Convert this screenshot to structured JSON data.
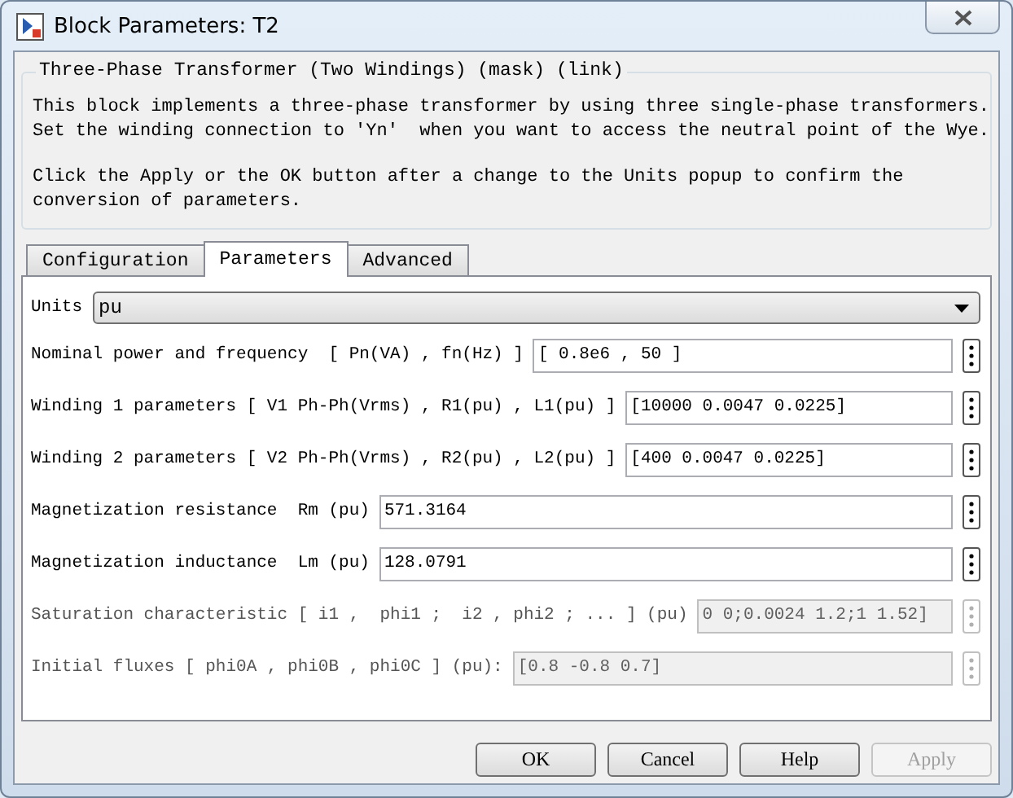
{
  "window": {
    "title": "Block Parameters: T2"
  },
  "description": {
    "title": "Three-Phase Transformer (Two Windings) (mask) (link)",
    "paragraphs": [
      "This block implements a three-phase transformer by using three single-phase transformers.\nSet the winding connection to 'Yn'  when you want to access the neutral point of the Wye.",
      "Click the Apply or the OK button after a change to the Units popup to confirm the\nconversion of parameters."
    ]
  },
  "tabs": [
    {
      "label": "Configuration",
      "selected": false
    },
    {
      "label": "Parameters",
      "selected": true
    },
    {
      "label": "Advanced",
      "selected": false
    }
  ],
  "units": {
    "label": "Units",
    "value": "pu"
  },
  "parameters": [
    {
      "label": "Nominal power and frequency  [ Pn(VA) , fn(Hz) ]",
      "value": "[ 0.8e6 , 50 ]",
      "disabled": false
    },
    {
      "label": "Winding 1 parameters [ V1 Ph-Ph(Vrms) , R1(pu) , L1(pu) ]",
      "value": "[10000 0.0047 0.0225]",
      "disabled": false
    },
    {
      "label": "Winding 2 parameters [ V2 Ph-Ph(Vrms) , R2(pu) , L2(pu) ]",
      "value": "[400 0.0047 0.0225]",
      "disabled": false
    },
    {
      "label": "Magnetization resistance  Rm (pu)",
      "value": "571.3164",
      "disabled": false
    },
    {
      "label": "Magnetization inductance  Lm (pu)",
      "value": "128.0791",
      "disabled": false
    },
    {
      "label": "Saturation characteristic [ i1 ,  phi1 ;  i2 , phi2 ; ... ] (pu)",
      "value": "0 0;0.0024 1.2;1 1.52]",
      "disabled": true
    },
    {
      "label": "Initial fluxes [ phi0A , phi0B , phi0C ] (pu):",
      "value": "[0.8 -0.8 0.7]",
      "disabled": true
    }
  ],
  "buttons": [
    {
      "label": "OK",
      "disabled": false
    },
    {
      "label": "Cancel",
      "disabled": false
    },
    {
      "label": "Help",
      "disabled": false
    },
    {
      "label": "Apply",
      "disabled": true
    }
  ]
}
